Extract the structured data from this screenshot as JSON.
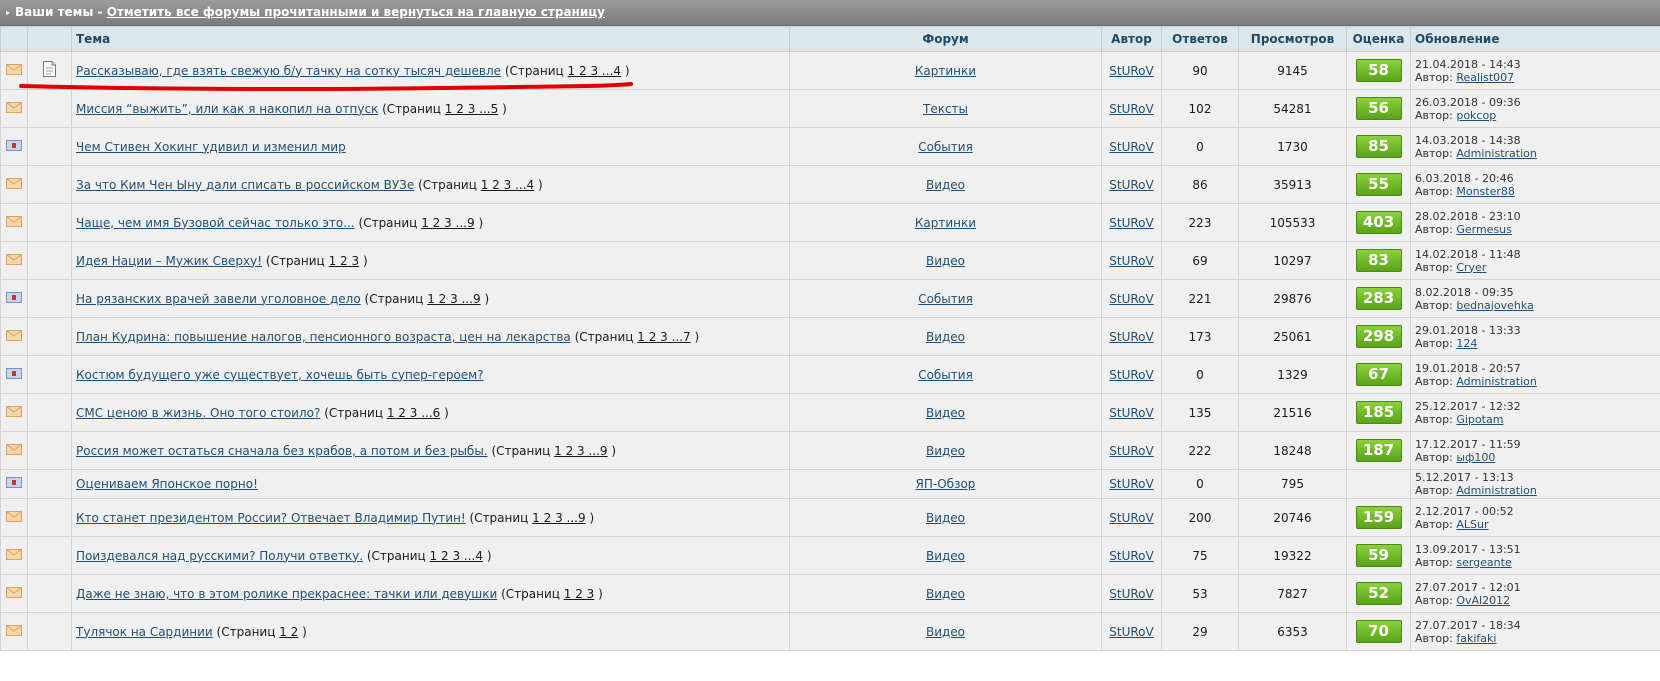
{
  "header": {
    "title": "Ваши темы",
    "separator": " - ",
    "mark_all_link": "Отметить все форумы прочитанными и вернуться на главную страницу"
  },
  "columns": {
    "topic": "Тема",
    "forum": "Форум",
    "author": "Автор",
    "replies": "Ответов",
    "views": "Просмотров",
    "rating": "Оценка",
    "updated": "Обновление"
  },
  "labels": {
    "pages_prefix": "(Страниц",
    "pages_suffix": ")",
    "author_prefix": "Автор:"
  },
  "rows": [
    {
      "status_icon": "envelope-icon",
      "type_icon": "document-icon",
      "topic": "Рассказываю, где взять свежую б/у тачку на сотку тысяч дешевле",
      "pages": "1 2 3 ...4",
      "forum": "Картинки",
      "author": "StURoV",
      "replies": "90",
      "views": "9145",
      "rating": "58",
      "updated": "21.04.2018 - 14:43",
      "last_author": "Realist007"
    },
    {
      "status_icon": "envelope-icon",
      "type_icon": "",
      "topic": "Миссия “выжить”, или как я накопил на отпуск",
      "pages": "1 2 3 ...5",
      "forum": "Тексты",
      "author": "StURoV",
      "replies": "102",
      "views": "54281",
      "rating": "56",
      "updated": "26.03.2018 - 09:36",
      "last_author": "pokcop"
    },
    {
      "status_icon": "poll-icon",
      "type_icon": "",
      "topic": "Чем Стивен Хокинг удивил и изменил мир",
      "pages": "",
      "forum": "События",
      "author": "StURoV",
      "replies": "0",
      "views": "1730",
      "rating": "85",
      "updated": "14.03.2018 - 14:38",
      "last_author": "Administration"
    },
    {
      "status_icon": "envelope-icon",
      "type_icon": "",
      "topic": "За что Ким Чен Ыну дали списать в российском ВУЗе",
      "pages": "1 2 3 ...4",
      "forum": "Видео",
      "author": "StURoV",
      "replies": "86",
      "views": "35913",
      "rating": "55",
      "updated": "6.03.2018 - 20:46",
      "last_author": "Monster88"
    },
    {
      "status_icon": "envelope-icon",
      "type_icon": "",
      "topic": "Чаще, чем имя Бузовой сейчас только это...",
      "pages": "1 2 3 ...9",
      "forum": "Картинки",
      "author": "StURoV",
      "replies": "223",
      "views": "105533",
      "rating": "403",
      "updated": "28.02.2018 - 23:10",
      "last_author": "Germesus"
    },
    {
      "status_icon": "envelope-icon",
      "type_icon": "",
      "topic": "Идея Нации – Мужик Сверху!",
      "pages": "1 2 3",
      "forum": "Видео",
      "author": "StURoV",
      "replies": "69",
      "views": "10297",
      "rating": "83",
      "updated": "14.02.2018 - 11:48",
      "last_author": "Cryer"
    },
    {
      "status_icon": "poll-icon",
      "type_icon": "",
      "topic": "На рязанских врачей завели уголовное дело",
      "pages": "1 2 3 ...9",
      "forum": "События",
      "author": "StURoV",
      "replies": "221",
      "views": "29876",
      "rating": "283",
      "updated": "8.02.2018 - 09:35",
      "last_author": "bednajovehka"
    },
    {
      "status_icon": "envelope-icon",
      "type_icon": "",
      "topic": "План Кудрина: повышение налогов, пенсионного возраста, цен на лекарства",
      "pages": "1 2 3 ...7",
      "forum": "Видео",
      "author": "StURoV",
      "replies": "173",
      "views": "25061",
      "rating": "298",
      "updated": "29.01.2018 - 13:33",
      "last_author": "124"
    },
    {
      "status_icon": "poll-icon",
      "type_icon": "",
      "topic": "Костюм будущего уже существует, хочешь быть супер-героем?",
      "pages": "",
      "forum": "События",
      "author": "StURoV",
      "replies": "0",
      "views": "1329",
      "rating": "67",
      "updated": "19.01.2018 - 20:57",
      "last_author": "Administration"
    },
    {
      "status_icon": "envelope-icon",
      "type_icon": "",
      "topic": "СМС ценою в жизнь. Оно того стоило?",
      "pages": "1 2 3 ...6",
      "forum": "Видео",
      "author": "StURoV",
      "replies": "135",
      "views": "21516",
      "rating": "185",
      "updated": "25.12.2017 - 12:32",
      "last_author": "Gipotam"
    },
    {
      "status_icon": "envelope-icon",
      "type_icon": "",
      "topic": "Россия может остаться сначала без крабов, а потом и без рыбы.",
      "pages": "1 2 3 ...9",
      "forum": "Видео",
      "author": "StURoV",
      "replies": "222",
      "views": "18248",
      "rating": "187",
      "updated": "17.12.2017 - 11:59",
      "last_author": "ыф100"
    },
    {
      "status_icon": "poll-icon",
      "type_icon": "",
      "topic": "Оцениваем Японское порно!",
      "pages": "",
      "forum": "ЯП-Обзор",
      "author": "StURoV",
      "replies": "0",
      "views": "795",
      "rating": "",
      "updated": "5.12.2017 - 13:13",
      "last_author": "Administration"
    },
    {
      "status_icon": "envelope-icon",
      "type_icon": "",
      "topic": "Кто станет президентом России? Отвечает Владимир Путин!",
      "pages": "1 2 3 ...9",
      "forum": "Видео",
      "author": "StURoV",
      "replies": "200",
      "views": "20746",
      "rating": "159",
      "updated": "2.12.2017 - 00:52",
      "last_author": "ALSur"
    },
    {
      "status_icon": "envelope-icon",
      "type_icon": "",
      "topic": "Поиздевался над русскими? Получи ответку.",
      "pages": "1 2 3 ...4",
      "forum": "Видео",
      "author": "StURoV",
      "replies": "75",
      "views": "19322",
      "rating": "59",
      "updated": "13.09.2017 - 13:51",
      "last_author": "sergeante"
    },
    {
      "status_icon": "envelope-icon",
      "type_icon": "",
      "topic": "Даже не знаю, что в этом ролике прекраснее: тачки или девушки",
      "pages": "1 2 3",
      "forum": "Видео",
      "author": "StURoV",
      "replies": "53",
      "views": "7827",
      "rating": "52",
      "updated": "27.07.2017 - 12:01",
      "last_author": "OvAl2012"
    },
    {
      "status_icon": "envelope-icon",
      "type_icon": "",
      "topic": "Тулячок на Сардинии",
      "pages": "1 2",
      "forum": "Видео",
      "author": "StURoV",
      "replies": "29",
      "views": "6353",
      "rating": "70",
      "updated": "27.07.2017 - 18:34",
      "last_author": "fakifaki"
    }
  ],
  "colors": {
    "header_bar": "#8a8a8a",
    "column_header_bg": "#dde6ea",
    "row_bg": "#f0f0f0",
    "link": "#1f4f78",
    "rating_green": "#6cb524",
    "annotation_red": "#e00000"
  }
}
